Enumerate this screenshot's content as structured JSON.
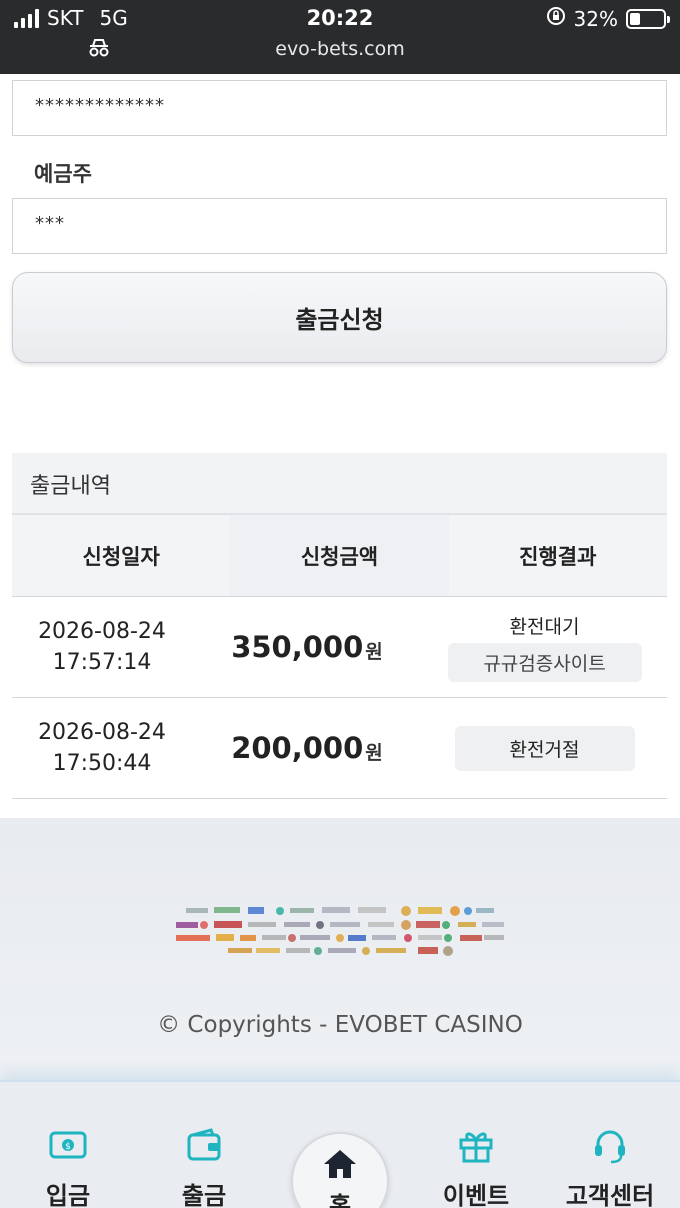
{
  "status_bar": {
    "carrier": "SKT",
    "network": "5G",
    "time": "20:22",
    "url": "evo-bets.com",
    "battery": "32%"
  },
  "form": {
    "account_number_value": "*************",
    "holder_label": "예금주",
    "holder_value": "***",
    "submit_label": "출금신청"
  },
  "history": {
    "title": "출금내역",
    "columns": [
      "신청일자",
      "신청금액",
      "진행결과"
    ],
    "rows": [
      {
        "date": "2026-08-24",
        "time": "17:57:14",
        "amount": "350,000",
        "currency": "원",
        "status": "환전대기",
        "note": "규규검증사이트"
      },
      {
        "date": "2026-08-24",
        "time": "17:50:44",
        "amount": "200,000",
        "currency": "원",
        "status": "환전거절"
      }
    ]
  },
  "footer": {
    "copyright": "© Copyrights - EVOBET CASINO"
  },
  "bottom_nav": {
    "deposit": "입금",
    "withdraw": "출금",
    "home": "홈",
    "events": "이벤트",
    "support": "고객센터"
  },
  "colors": {
    "accent": "#1fb5c0",
    "status_bar_bg": "#2a2b2d"
  }
}
